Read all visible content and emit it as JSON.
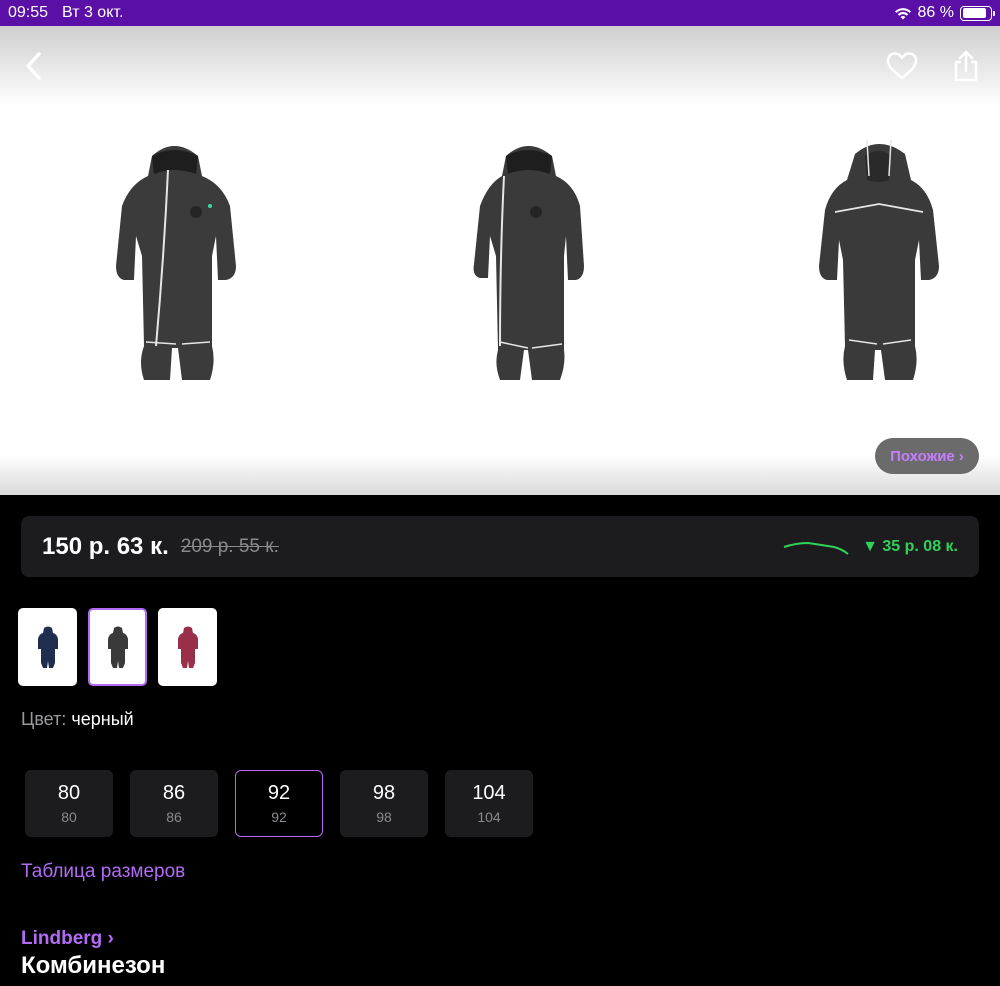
{
  "status_bar": {
    "time": "09:55",
    "date": "Вт 3 окт.",
    "battery": "86 %",
    "battery_level": 0.86
  },
  "gallery": {
    "similar_button": "Похожие ›",
    "icons": [
      "back-chevron-icon",
      "heart-icon",
      "share-icon"
    ]
  },
  "price": {
    "current": "150 р.  63 к.",
    "old": "209 р.  55 к.",
    "drop": "▼ 35 р.  08 к.",
    "drop_color": "#30d158"
  },
  "color": {
    "label": "Цвет:",
    "value": "черный",
    "thumbs": [
      {
        "name": "navy",
        "color": "#1f2d4f"
      },
      {
        "name": "black",
        "color": "#3a3a3a",
        "selected": true
      },
      {
        "name": "berry",
        "color": "#9a2f4a"
      }
    ]
  },
  "sizes": [
    {
      "main": "80",
      "sub": "80"
    },
    {
      "main": "86",
      "sub": "86"
    },
    {
      "main": "92",
      "sub": "92",
      "selected": true
    },
    {
      "main": "98",
      "sub": "98"
    },
    {
      "main": "104",
      "sub": "104"
    }
  ],
  "size_table_link": "Таблица размеров",
  "brand": "Lindberg ›",
  "product_title": "Комбинезон",
  "accent_color": "#b36bf5",
  "status_bar_color": "#5a0fa6"
}
